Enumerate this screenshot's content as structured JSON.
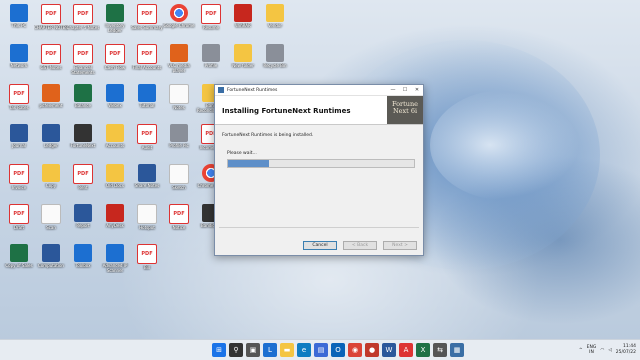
{
  "colors": {
    "accent": "#3c7fb1",
    "progress_fill": "#5e8fc9",
    "logo_bg": "#5b5a55"
  },
  "desktop_icons": [
    {
      "label": "This PC",
      "icon": "pc-icon",
      "kind": "g-blue"
    },
    {
      "label": "CHAPTER NOTES",
      "icon": "pdf-icon",
      "kind": "g-pdf"
    },
    {
      "label": "Chapter 5 Notes",
      "icon": "pdf-icon",
      "kind": "g-pdf"
    },
    {
      "label": "Inventory Ledger",
      "icon": "excel-icon",
      "kind": "g-xls"
    },
    {
      "label": "Sales Summary",
      "icon": "pdf-icon",
      "kind": "g-pdf"
    },
    {
      "label": "Google Chrome",
      "icon": "chrome-icon",
      "kind": "g-chrome"
    },
    {
      "label": "Resume",
      "icon": "pdf-icon",
      "kind": "g-pdf"
    },
    {
      "label": "WinRAR",
      "icon": "winrar-icon",
      "kind": "g-red"
    },
    {
      "label": "Vendor",
      "icon": "folder-icon",
      "kind": "g-folder"
    },
    {
      "label": "Network",
      "icon": "network-icon",
      "kind": "g-blue"
    },
    {
      "label": "GST Notes",
      "icon": "pdf-icon",
      "kind": "g-pdf"
    },
    {
      "label": "Financial Statements",
      "icon": "pdf-icon",
      "kind": "g-pdf"
    },
    {
      "label": "Cash Flow",
      "icon": "pdf-icon",
      "kind": "g-pdf"
    },
    {
      "label": "Final Accounts",
      "icon": "pdf-icon",
      "kind": "g-pdf"
    },
    {
      "label": "VLC media player",
      "icon": "vlc-icon",
      "kind": "g-orange"
    },
    {
      "label": "Profile",
      "icon": "photo-icon",
      "kind": "g-gray"
    },
    {
      "label": "New folder",
      "icon": "folder-icon",
      "kind": "g-folder"
    },
    {
      "label": "Recycle Bin",
      "icon": "recycle-bin-icon",
      "kind": "g-gray"
    },
    {
      "label": "Tax Rates",
      "icon": "pdf-icon",
      "kind": "g-pdf"
    },
    {
      "label": "pdfelement",
      "icon": "pdfelement-icon",
      "kind": "g-orange"
    },
    {
      "label": "Balance",
      "icon": "excel-icon",
      "kind": "g-xls"
    },
    {
      "label": "Webex",
      "icon": "webex-icon",
      "kind": "g-blue"
    },
    {
      "label": "Tutorial",
      "icon": "app-icon",
      "kind": "g-blue"
    },
    {
      "label": "Notes",
      "icon": "file-icon",
      "kind": "g-white"
    },
    {
      "label": "Bank Reconciliation",
      "icon": "folder-icon",
      "kind": "g-folder"
    },
    {
      "label": "TDS",
      "icon": "pdf-icon",
      "kind": "g-pdf"
    },
    {
      "label": "Capital A/c",
      "icon": "pdf-icon",
      "kind": "g-pdf"
    },
    {
      "label": "Journal",
      "icon": "word-icon",
      "kind": "g-word"
    },
    {
      "label": "Ledger",
      "icon": "word-icon",
      "kind": "g-word"
    },
    {
      "label": "FortuneNext",
      "icon": "fortunenext-icon",
      "kind": "g-dark"
    },
    {
      "label": "Accounts",
      "icon": "folder-icon",
      "kind": "g-folder"
    },
    {
      "label": "Audit",
      "icon": "pdf-icon",
      "kind": "g-pdf"
    },
    {
      "label": "Profile Pic",
      "icon": "photo-icon",
      "kind": "g-gray"
    },
    {
      "label": "Income Tax",
      "icon": "pdf-icon",
      "kind": "g-pdf"
    },
    {
      "label": "Summary",
      "icon": "word-icon",
      "kind": "g-word"
    },
    {
      "label": "Greenshot",
      "icon": "greenshot-icon",
      "kind": "g-green"
    },
    {
      "label": "Invoice",
      "icon": "pdf-icon",
      "kind": "g-pdf"
    },
    {
      "label": "Copy",
      "icon": "folder-icon",
      "kind": "g-folder"
    },
    {
      "label": "Rent",
      "icon": "pdf-icon",
      "kind": "g-pdf"
    },
    {
      "label": "Old Docs",
      "icon": "folder-icon",
      "kind": "g-folder"
    },
    {
      "label": "Share Notes",
      "icon": "word-icon",
      "kind": "g-word"
    },
    {
      "label": "Sketch",
      "icon": "app-icon",
      "kind": "g-white"
    },
    {
      "label": "Chrome Apps",
      "icon": "chrome-icon",
      "kind": "g-chrome"
    },
    {
      "label": "Trial Balance",
      "icon": "pdf-icon",
      "kind": "g-pdf"
    },
    {
      "label": "Misc",
      "icon": "folder-icon",
      "kind": "g-folder"
    },
    {
      "label": "Draft",
      "icon": "pdf-icon",
      "kind": "g-pdf"
    },
    {
      "label": "Scan",
      "icon": "file-icon",
      "kind": "g-white"
    },
    {
      "label": "Report",
      "icon": "word-icon",
      "kind": "g-word"
    },
    {
      "label": "AnyDesk",
      "icon": "anydesk-icon",
      "kind": "g-red"
    },
    {
      "label": "Hotspot",
      "icon": "file-icon",
      "kind": "g-white"
    },
    {
      "label": "Notice",
      "icon": "pdf-icon",
      "kind": "g-pdf"
    },
    {
      "label": "Bandicam",
      "icon": "bandicam-icon",
      "kind": "g-dark"
    },
    {
      "label": "Control Panel",
      "icon": "control-panel-icon",
      "kind": "g-blue"
    },
    {
      "label": "CASH FLOW",
      "icon": "pdf-icon",
      "kind": "g-pdf"
    },
    {
      "label": "Copy of Sales",
      "icon": "excel-icon",
      "kind": "g-xls"
    },
    {
      "label": "Computation",
      "icon": "word-icon",
      "kind": "g-word"
    },
    {
      "label": "Toolbox",
      "icon": "toolbox-icon",
      "kind": "g-blue"
    },
    {
      "label": "Advanced IP Scanner",
      "icon": "scanner-icon",
      "kind": "g-blue"
    },
    {
      "label": "Bill",
      "icon": "pdf-icon",
      "kind": "g-pdf"
    }
  ],
  "dialog": {
    "window_title": "FortuneNext Runtimes",
    "header_title": "Installing FortuneNext Runtimes",
    "logo_line1": "Fortune",
    "logo_line2": "Next 6i",
    "status_text": "FortuneNext Runtimes is being installed.",
    "wait_text": "Please wait...",
    "progress": 0.22,
    "cancel_label": "Cancel",
    "back_label": "< Back",
    "next_label": "Next >"
  },
  "taskbar": {
    "apps": [
      {
        "icon": "start-icon",
        "glyph": "⊞",
        "color": "#1a73e8"
      },
      {
        "icon": "search-icon",
        "glyph": "⚲",
        "color": "#333"
      },
      {
        "icon": "task-view-icon",
        "glyph": "▣",
        "color": "#555"
      },
      {
        "icon": "app-l-icon",
        "glyph": "L",
        "color": "#1c6fd1"
      },
      {
        "icon": "file-explorer-icon",
        "glyph": "▬",
        "color": "#f4c542"
      },
      {
        "icon": "edge-icon",
        "glyph": "e",
        "color": "#0f7dc2"
      },
      {
        "icon": "store-icon",
        "glyph": "▤",
        "color": "#3c6ad6"
      },
      {
        "icon": "outlook-icon",
        "glyph": "O",
        "color": "#0a64b8"
      },
      {
        "icon": "chrome-icon",
        "glyph": "◉",
        "color": "#db4437"
      },
      {
        "icon": "record-icon",
        "glyph": "●",
        "color": "#c0392b"
      },
      {
        "icon": "word-icon",
        "glyph": "W",
        "color": "#2b579a"
      },
      {
        "icon": "pdf-icon",
        "glyph": "A",
        "color": "#d33"
      },
      {
        "icon": "excel-icon",
        "glyph": "X",
        "color": "#1e7145"
      },
      {
        "icon": "network-tool-icon",
        "glyph": "⇆",
        "color": "#555"
      },
      {
        "icon": "installer-icon",
        "glyph": "▦",
        "color": "#3a6ea5"
      }
    ],
    "lang_line1": "ENG",
    "lang_line2": "IN",
    "time": "11:44",
    "date": "25/07/22"
  }
}
